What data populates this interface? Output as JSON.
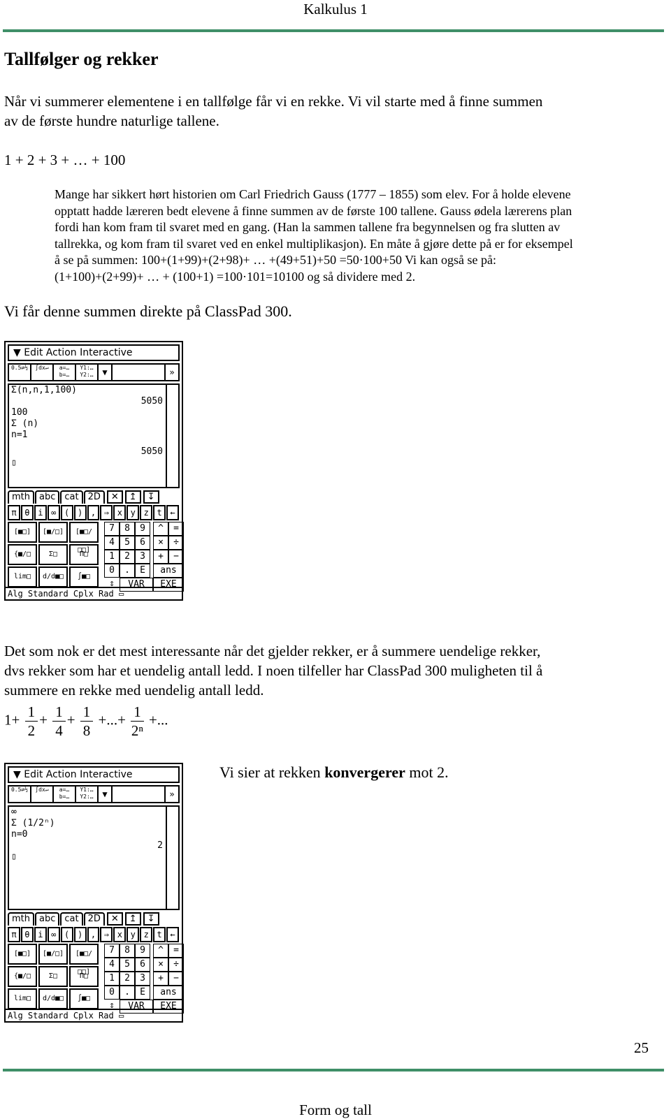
{
  "header": {
    "title": "Kalkulus 1"
  },
  "heading": "Tallfølger og rekker",
  "intro": {
    "line1": "Når vi summerer elementene i en tallfølge får vi en rekke. Vi vil starte med å finne summen",
    "line2": "av de første hundre naturlige tallene.",
    "expression": "1 + 2 + 3 +  …  + 100"
  },
  "gauss": {
    "lines": [
      "Mange har sikkert hørt historien om Carl Friedrich Gauss (1777 – 1855) som elev. For å holde elevene",
      "opptatt hadde læreren bedt elevene å finne summen av de første 100 tallene. Gauss ødela lærerens plan",
      "fordi han kom fram til svaret med en gang. (Han la sammen tallene fra begynnelsen og fra slutten av",
      "tallrekka, og kom fram til svaret ved en enkel multiplikasjon). En måte å gjøre dette på er for eksempel",
      "å se på summen: 100+(1+99)+(2+98)+ … +(49+51)+50 =50·100+50 Vi kan også se på:",
      "(1+100)+(2+99)+ … + (100+1) =100·101=10100 og så dividere med 2."
    ]
  },
  "classpad_line": "Vi får denne summen direkte på ClassPad 300.",
  "calc1": {
    "menu": "Edit Action Interactive",
    "toolbar": [
      "0.5⇄½",
      "∫dx↵",
      "a=… b=…",
      "Y1:… Y2:…",
      "▼"
    ],
    "entries": [
      {
        "input": "Σ(n,n,1,100)",
        "result": "5050"
      },
      {
        "input_top": "100",
        "input_mid": "Σ (n)",
        "input_bottom": "n=1",
        "result": "5050"
      }
    ]
  },
  "calc2": {
    "menu": "Edit Action Interactive",
    "toolbar": [
      "0.5⇄½",
      "∫dx↵",
      "a=… b=…",
      "Y1:… Y2:…",
      "▼"
    ],
    "entries": [
      {
        "input_top": "∞",
        "input_mid": "Σ (1/2ⁿ)",
        "input_bottom": "n=0",
        "result": "2"
      }
    ]
  },
  "keyboard": {
    "tabs": [
      "mth",
      "abc",
      "cat",
      "2D"
    ],
    "tab_icons": [
      "✕",
      "↥",
      "↧"
    ],
    "symbols": [
      "π",
      "θ",
      "i",
      "∞",
      "(",
      ")",
      ",",
      "⇒",
      "x",
      "y",
      "z",
      "t",
      "←"
    ],
    "templates": [
      "[■□]",
      "[■/□]",
      "[■□/□□]",
      "{■/□",
      "Σ□",
      "Π□",
      "lim□",
      "d/d■□",
      "∫■□"
    ],
    "numpad": [
      "7",
      "8",
      "9",
      "^",
      "=",
      "4",
      "5",
      "6",
      "×",
      "÷",
      "1",
      "2",
      "3",
      "+",
      "−",
      "0",
      ".",
      "E",
      "ans"
    ],
    "var": "VAR",
    "exe": "EXE",
    "status": "Alg    Standard Cplx Rad"
  },
  "infinite": {
    "line1": "Det som nok er det mest interessante når det gjelder rekker, er å summere uendelige rekker,",
    "line2": "dvs rekker som har et uendelig antall ledd. I noen tilfeller har ClassPad 300 muligheten til å",
    "line3": "summere en rekke med uendelig antall ledd.",
    "series_lead": "1+",
    "fractions": [
      {
        "n": "1",
        "d": "2"
      },
      {
        "n": "1",
        "d": "4"
      },
      {
        "n": "1",
        "d": "8"
      }
    ],
    "ellipsis": "+...+",
    "general": {
      "n": "1",
      "d": "2ⁿ"
    },
    "tail": "+..."
  },
  "converge": {
    "pre": "Vi sier at rekken ",
    "bold": "konvergerer",
    "post": " mot 2."
  },
  "footer": {
    "page": "25",
    "title": "Form og tall"
  }
}
